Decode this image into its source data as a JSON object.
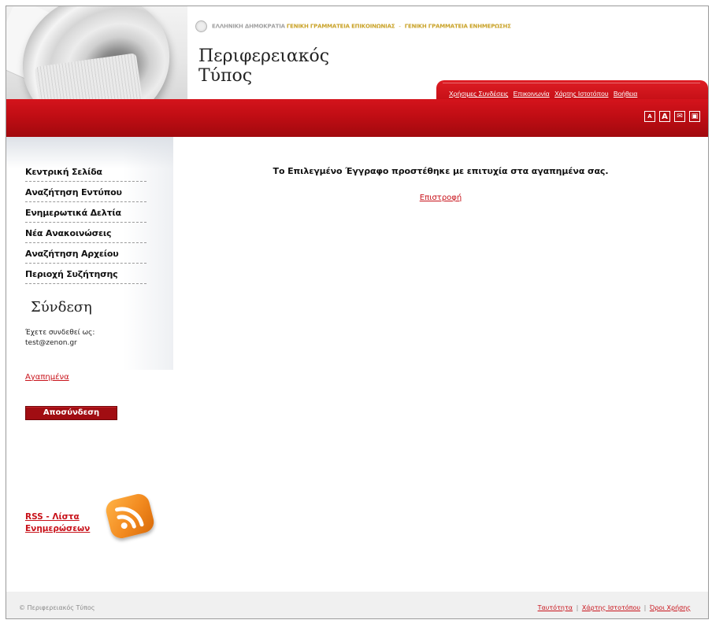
{
  "header": {
    "gov_primary": "ΕΛΛΗΝΙΚΗ ΔΗΜΟΚΡΑΤΙΑ",
    "gov_secondary": "ΓΕΝΙΚΗ ΓΡΑΜΜΑΤΕΙΑ ΕΠΙΚΟΙΝΩΝΙΑΣ",
    "gov_separator": "-",
    "gov_tertiary": "ΓΕΝΙΚΗ ΓΡΑΜΜΑΤΕΙΑ ΕΝΗΜΕΡΩΣΗΣ",
    "title_line1": "Περιφερειακός",
    "title_line2": "Τύπος",
    "top_links": [
      "Χρήσιμες Συνδέσεις",
      "Επικοινωνία",
      "Χάρτης Ιστοτόπου",
      "Βοήθεια"
    ],
    "util_icons": [
      {
        "name": "font-smaller-icon",
        "glyph": "A"
      },
      {
        "name": "font-larger-icon",
        "glyph": "A"
      },
      {
        "name": "email-icon",
        "glyph": "✉"
      },
      {
        "name": "print-icon",
        "glyph": "▣"
      }
    ]
  },
  "nav": {
    "items": [
      "Κεντρική Σελίδα",
      "Αναζήτηση Εντύπου",
      "Ενημερωτικά Δελτία",
      "Νέα Ανακοινώσεις",
      "Αναζήτηση Αρχείου",
      "Περιοχή Συζήτησης"
    ]
  },
  "login": {
    "title": "Σύνδεση",
    "label": "Έχετε συνδεθεί ως:",
    "user": "test@zenon.gr",
    "favorites": "Αγαπημένα",
    "logout": "Αποσύνδεση"
  },
  "rss": {
    "label": "RSS - Λίστα Ενημερώσεων"
  },
  "main": {
    "message": "Το Επιλεγμένο Έγγραφο προστέθηκε με επιτυχία στα αγαπημένα σας.",
    "back": "Επιστροφή"
  },
  "footer": {
    "copyright": "© Περιφερειακός Τύπος",
    "links": [
      "Ταυτότητα",
      "Χάρτης Ιστοτόπου",
      "Όροι Χρήσης"
    ],
    "separator": "|"
  },
  "colors": {
    "brand_red": "#c00d14",
    "link_red": "#c8121a",
    "gold": "#c9a227"
  }
}
